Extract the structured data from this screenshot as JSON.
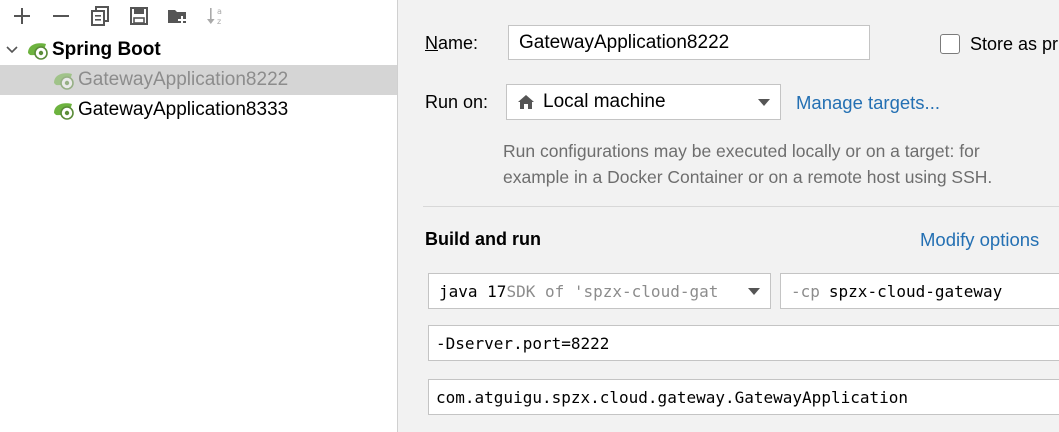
{
  "tree": {
    "root_label": "Spring Boot",
    "items": [
      {
        "label": "GatewayApplication8222",
        "selected": true,
        "dimmed": true
      },
      {
        "label": "GatewayApplication8333",
        "selected": false,
        "dimmed": false
      }
    ]
  },
  "toolbar": {
    "icons": [
      "add-icon",
      "remove-icon",
      "copy-icon",
      "save-icon",
      "new-folder-icon",
      "sort-alpha-icon"
    ]
  },
  "form": {
    "name_label_mnemonic": "N",
    "name_label_rest": "ame:",
    "name_value": "GatewayApplication8222",
    "store_label": "Store as pr",
    "store_checked": false,
    "run_on_label": "Run on:",
    "run_on_value": "Local machine",
    "manage_targets": "Manage targets...",
    "hint_line1": "Run configurations may be executed locally or on a target: for",
    "hint_line2": "example in a Docker Container or on a remote host using SSH.",
    "section_title": "Build and run",
    "modify_options": "Modify options",
    "jdk_keyword": "java 17",
    "jdk_detail": " SDK of 'spzx-cloud-gat",
    "cp_flag": "-cp",
    "cp_value": "spzx-cloud-gateway",
    "vm_options": "-Dserver.port=8222",
    "main_class": "com.atguigu.spzx.cloud.gateway.GatewayApplication"
  },
  "colors": {
    "link": "#2470b3",
    "spring_green": "#6db33f",
    "selection": "#d5d5d5"
  }
}
